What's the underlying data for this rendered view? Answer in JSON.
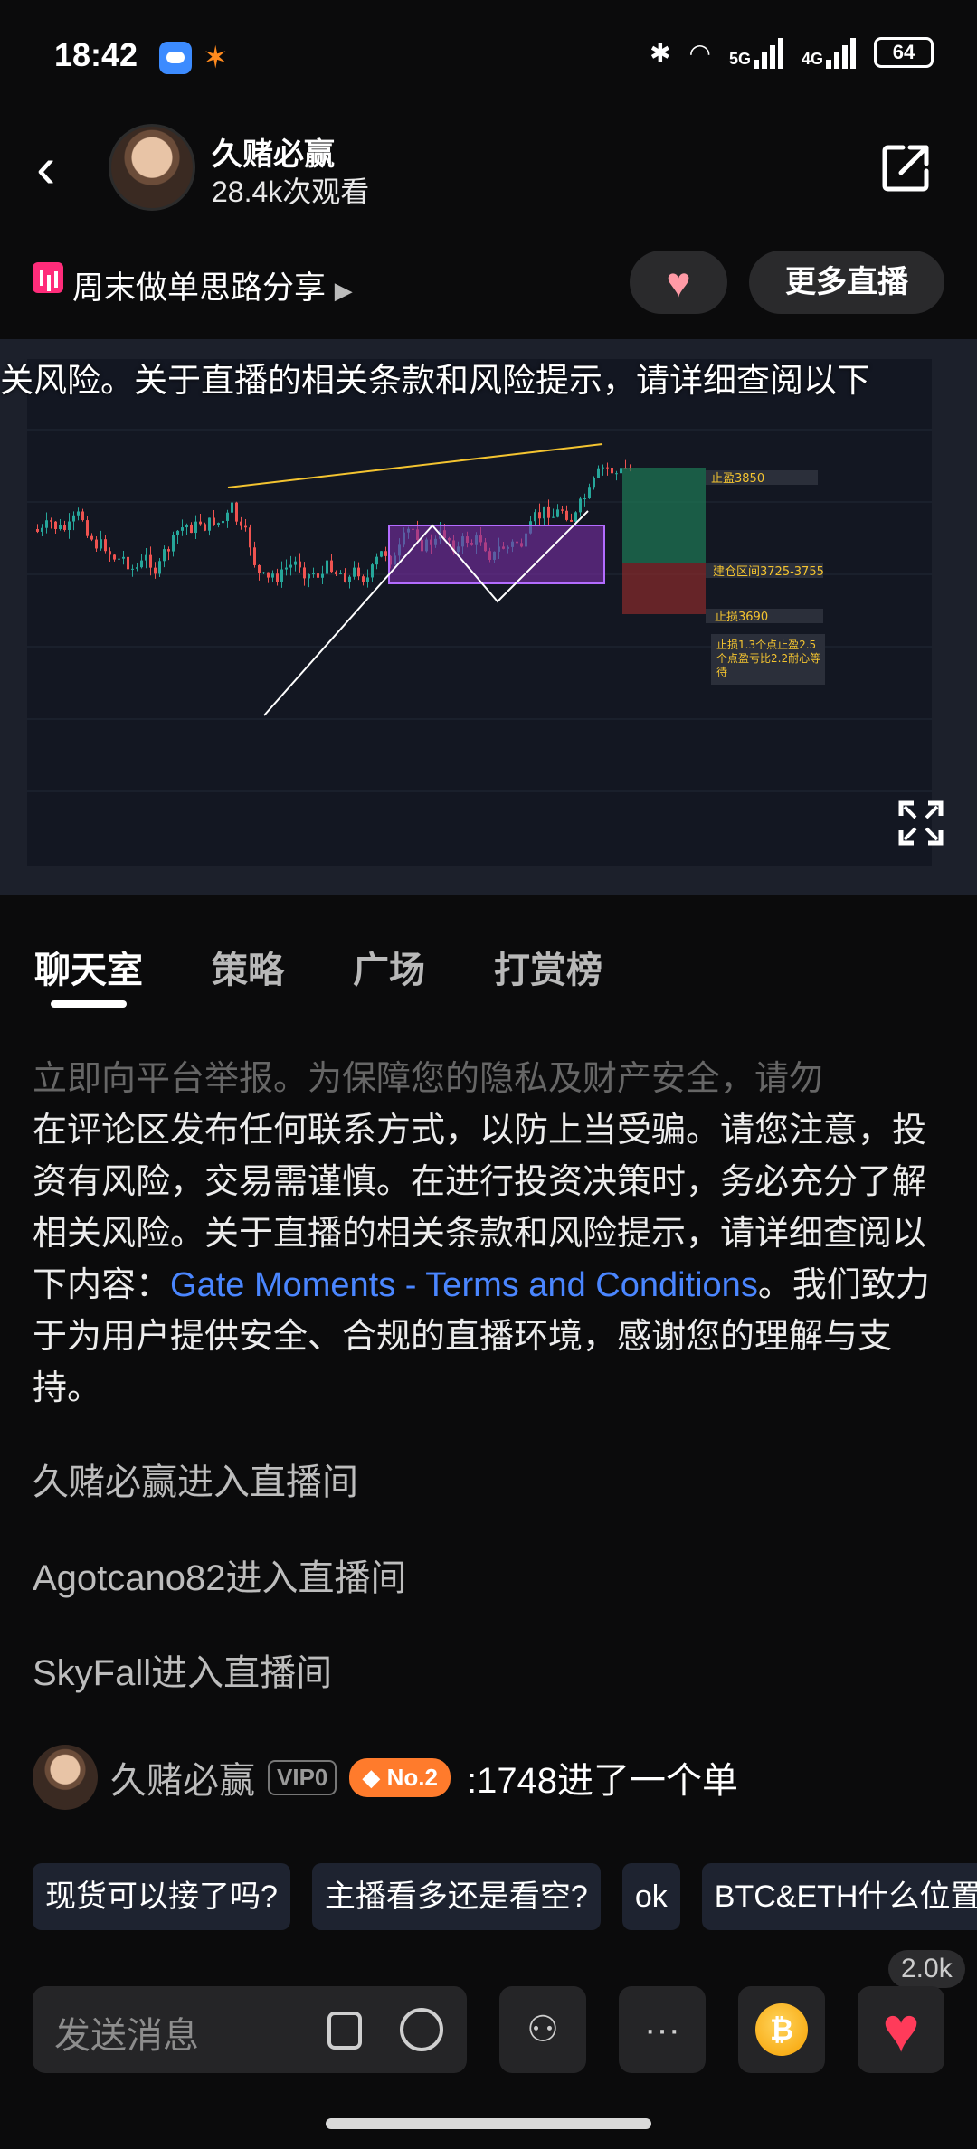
{
  "status_bar": {
    "time": "18:42",
    "network_1": "5G",
    "network_2": "4G",
    "battery": "64"
  },
  "header": {
    "host_name": "久赌必赢",
    "views": "28.4k次观看"
  },
  "subheader": {
    "topic": "周末做单思路分享",
    "more_live_label": "更多直播"
  },
  "video": {
    "marquee": "关风险。关于直播的相关条款和风险提示，请详细查阅以下",
    "chart_labels": {
      "take_profit": "止盈3850",
      "entry_zone": "建仓区间3725-3755",
      "stop_loss": "止损3690",
      "note_line1": "止损1.3个点止盈2.5",
      "note_line2": "个点盈亏比2.2耐心等",
      "note_line3": "待"
    }
  },
  "tabs": [
    "聊天室",
    "策略",
    "广场",
    "打赏榜"
  ],
  "notice": {
    "line_faded": "立即向平台举报。为保障您的隐私及财产安全，请勿",
    "body_before_link": "在评论区发布任何联系方式，以防上当受骗。请您注意，投资有风险，交易需谨慎。在进行投资决策时，务必充分了解相关风险。关于直播的相关条款和风险提示，请详细查阅以下内容：",
    "link_text": "Gate Moments - Terms and Conditions",
    "body_after_link": "。我们致力于为用户提供安全、合规的直播环境，感谢您的理解与支持。"
  },
  "chat": {
    "entries": [
      "久赌必赢进入直播间",
      "Agotcano82进入直播间",
      "SkyFall进入直播间"
    ],
    "message": {
      "user": "久赌必赢",
      "vip": "VIP0",
      "rank_badge": "No.2",
      "text": ":1748进了一个单"
    }
  },
  "quick_replies": [
    "现货可以接了吗?",
    "主播看多还是看空?",
    "ok",
    "BTC&ETH什么位置"
  ],
  "bottom_bar": {
    "input_placeholder": "发送消息",
    "like_count": "2.0k"
  }
}
